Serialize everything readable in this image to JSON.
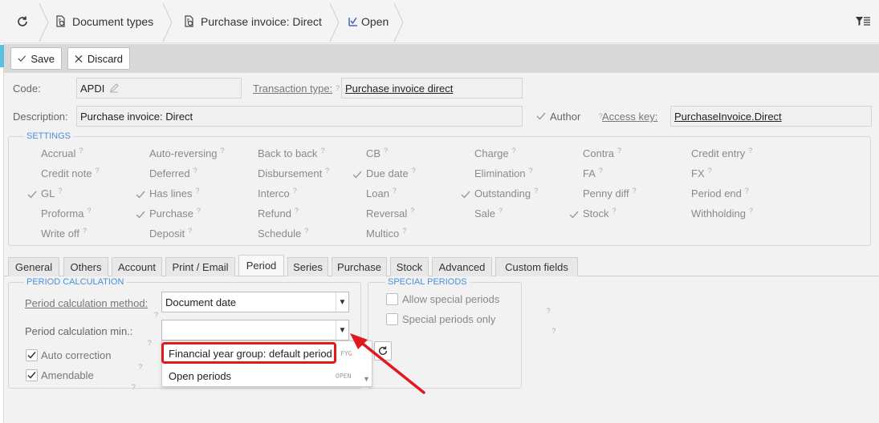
{
  "breadcrumb": {
    "items": [
      {
        "label": "Document types",
        "icon": "document-settings-icon"
      },
      {
        "label": "Purchase invoice: Direct",
        "icon": "document-settings-icon"
      },
      {
        "label": "Open",
        "icon": "open-checkbox-icon"
      }
    ]
  },
  "toolbar": {
    "save_label": "Save",
    "discard_label": "Discard"
  },
  "form": {
    "code_label": "Code:",
    "code_value": "APDI",
    "transaction_type_label": "Transaction type:",
    "transaction_type_value": "Purchase invoice direct",
    "description_label": "Description:",
    "description_value": "Purchase invoice: Direct",
    "author_label": "Author",
    "access_key_label": "Access key:",
    "access_key_value": "PurchaseInvoice.Direct",
    "help_mark": "?"
  },
  "settings": {
    "legend": "SETTINGS",
    "items": [
      {
        "label": "Accrual",
        "checked": false
      },
      {
        "label": "Auto-reversing",
        "checked": false
      },
      {
        "label": "Back to back",
        "checked": false
      },
      {
        "label": "CB",
        "checked": false
      },
      {
        "label": "Charge",
        "checked": false
      },
      {
        "label": "Contra",
        "checked": false
      },
      {
        "label": "Credit entry",
        "checked": false
      },
      {
        "label": "Credit note",
        "checked": false
      },
      {
        "label": "Deferred",
        "checked": false
      },
      {
        "label": "Disbursement",
        "checked": false
      },
      {
        "label": "Due date",
        "checked": true
      },
      {
        "label": "Elimination",
        "checked": false
      },
      {
        "label": "FA",
        "checked": false
      },
      {
        "label": "FX",
        "checked": false
      },
      {
        "label": "GL",
        "checked": true
      },
      {
        "label": "Has lines",
        "checked": true
      },
      {
        "label": "Interco",
        "checked": false
      },
      {
        "label": "Loan",
        "checked": false
      },
      {
        "label": "Outstanding",
        "checked": true
      },
      {
        "label": "Penny diff",
        "checked": false
      },
      {
        "label": "Period end",
        "checked": false
      },
      {
        "label": "Proforma",
        "checked": false
      },
      {
        "label": "Purchase",
        "checked": true
      },
      {
        "label": "Refund",
        "checked": false
      },
      {
        "label": "Reversal",
        "checked": false
      },
      {
        "label": "Sale",
        "checked": false
      },
      {
        "label": "Stock",
        "checked": true
      },
      {
        "label": "Withholding",
        "checked": false
      },
      {
        "label": "Write off",
        "checked": false
      },
      {
        "label": "Deposit",
        "checked": false
      },
      {
        "label": "Schedule",
        "checked": false
      },
      {
        "label": "Multico",
        "checked": false
      }
    ]
  },
  "tabs": [
    {
      "label": "General"
    },
    {
      "label": "Others"
    },
    {
      "label": "Account"
    },
    {
      "label": "Print / Email"
    },
    {
      "label": "Period",
      "active": true
    },
    {
      "label": "Series"
    },
    {
      "label": "Purchase"
    },
    {
      "label": "Stock"
    },
    {
      "label": "Advanced"
    },
    {
      "label": "Custom fields"
    }
  ],
  "period": {
    "legend": "PERIOD CALCULATION",
    "method_label": "Period calculation method:",
    "method_value": "Document date",
    "min_label": "Period calculation min.:",
    "min_value": "",
    "auto_correction_label": "Auto correction",
    "auto_correction_checked": true,
    "amendable_label": "Amendable",
    "amendable_checked": true,
    "dropdown_options": [
      {
        "label": "Financial year group: default period",
        "code": "FYG"
      },
      {
        "label": "Open periods",
        "code": "OPEN"
      }
    ]
  },
  "special": {
    "legend": "SPECIAL PERIODS",
    "allow_label": "Allow special periods",
    "allow_checked": false,
    "only_label": "Special periods only",
    "only_checked": false
  },
  "colors": {
    "accent": "#4a90d9",
    "annotation": "#e0191d"
  }
}
